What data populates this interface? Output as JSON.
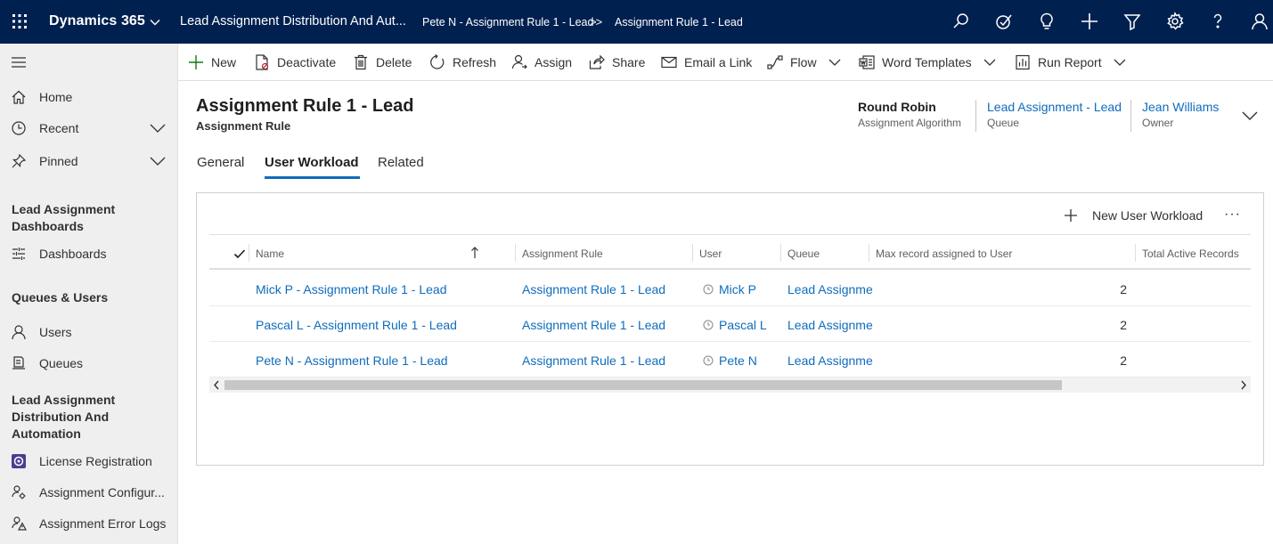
{
  "topbar": {
    "app_name": "Dynamics 365",
    "area_name": "Lead Assignment Distribution And Aut...",
    "breadcrumb_1": "Pete N - Assignment Rule 1 - Lead",
    "breadcrumb_sep": ">>",
    "breadcrumb_2": "Assignment Rule 1 - Lead",
    "icons": [
      "search-icon",
      "task-icon",
      "lightbulb-icon",
      "plus-icon",
      "filter-icon",
      "gear-icon",
      "help-icon",
      "user-icon"
    ],
    "bg_color": "#002050"
  },
  "commandbar": {
    "new": "New",
    "deactivate": "Deactivate",
    "delete": "Delete",
    "refresh": "Refresh",
    "assign": "Assign",
    "share": "Share",
    "email_link": "Email a Link",
    "flow": "Flow",
    "word_templates": "Word Templates",
    "run_report": "Run Report"
  },
  "sidebar": {
    "home": "Home",
    "recent": "Recent",
    "pinned": "Pinned",
    "group_1": "Lead Assignment Dashboards",
    "dashboards": "Dashboards",
    "group_2": "Queues & Users",
    "users": "Users",
    "queues": "Queues",
    "group_3": "Lead Assignment Distribution And Automation",
    "license_registration": "License Registration",
    "assignment_configuration": "Assignment Configur...",
    "assignment_error_logs": "Assignment Error Logs"
  },
  "record": {
    "title": "Assignment Rule 1 - Lead",
    "entity": "Assignment Rule",
    "algorithm_value": "Round Robin",
    "algorithm_label": "Assignment Algorithm",
    "queue_value": "Lead Assignment - Lead",
    "queue_label": "Queue",
    "owner_value": "Jean Williams",
    "owner_label": "Owner"
  },
  "tabs": {
    "general": "General",
    "user_workload": "User Workload",
    "related": "Related",
    "active": "User Workload"
  },
  "subgrid": {
    "new_button": "New User Workload",
    "more": "···",
    "columns": {
      "name": "Name",
      "assignment_rule": "Assignment Rule",
      "user": "User",
      "queue": "Queue",
      "max_record": "Max record assigned to User",
      "total_active": "Total Active Records"
    },
    "rows": [
      {
        "name": "Mick P - Assignment Rule 1 - Lead",
        "rule": "Assignment Rule 1 - Lead",
        "user": "Mick P",
        "queue": "Lead Assignme",
        "max": "2"
      },
      {
        "name": "Pascal L - Assignment Rule 1 - Lead",
        "rule": "Assignment Rule 1 - Lead",
        "user": "Pascal L",
        "queue": "Lead Assignme",
        "max": "2"
      },
      {
        "name": "Pete N - Assignment Rule 1 - Lead",
        "rule": "Assignment Rule 1 - Lead",
        "user": "Pete N",
        "queue": "Lead Assignme",
        "max": "2"
      }
    ]
  },
  "colors": {
    "link": "#0f6cbd",
    "nav_bg": "#efefef",
    "accent": "#0f6cbd"
  }
}
